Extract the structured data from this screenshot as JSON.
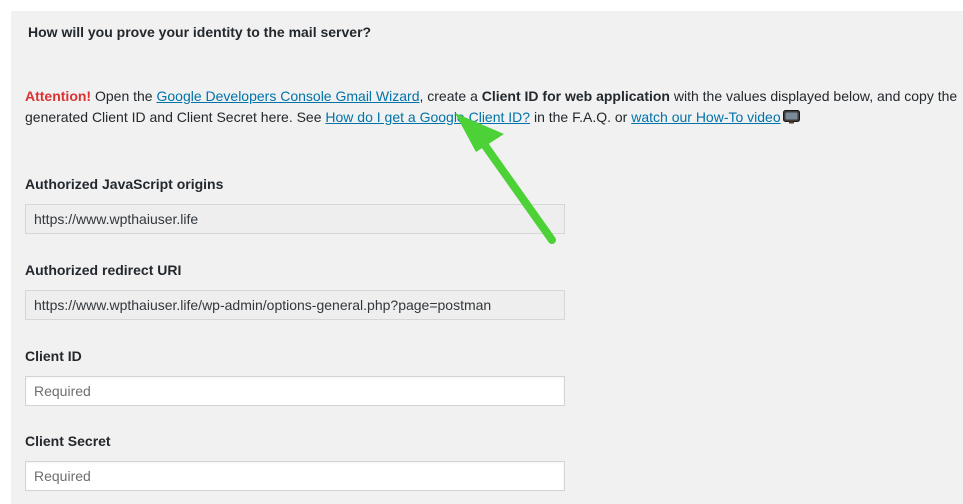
{
  "section": {
    "heading": "How will you prove your identity to the mail server?"
  },
  "instructions": {
    "attention": "Attention!",
    "text_open": " Open the ",
    "wizard_link": "Google Developers Console Gmail Wizard",
    "text_create": ", create a ",
    "client_id_bold": "Client ID for web application",
    "text_values": " with the values displayed below, and copy the generated Client ID and Client Secret here. See ",
    "faq_link": "How do I get a Google Client ID?",
    "text_faq": " in the F.A.Q. or ",
    "video_link": "watch our How-To video",
    "video_icon": "tv-icon"
  },
  "fields": {
    "js_origins": {
      "label": "Authorized JavaScript origins",
      "value": "https://www.wpthaiuser.life"
    },
    "redirect_uri": {
      "label": "Authorized redirect URI",
      "value": "https://www.wpthaiuser.life/wp-admin/options-general.php?page=postman"
    },
    "client_id": {
      "label": "Client ID",
      "value": "",
      "placeholder": "Required"
    },
    "client_secret": {
      "label": "Client Secret",
      "value": "",
      "placeholder": "Required"
    }
  },
  "annotation": {
    "arrow_color": "#4cd137",
    "arrow_icon": "arrow-annotation"
  }
}
